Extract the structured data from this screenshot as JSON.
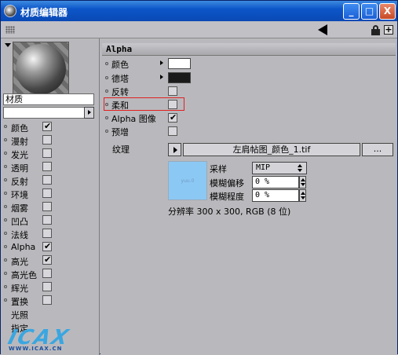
{
  "window": {
    "title": "材质编辑器",
    "controls": {
      "minimize": "_",
      "maximize": "□",
      "close": "X"
    }
  },
  "toolbar": {
    "icons": [
      "grip-icon",
      "back-arrow-icon",
      "lock-icon",
      "plus-icon"
    ],
    "plus_label": "+"
  },
  "left_panel": {
    "material_name": "材质",
    "channels": [
      {
        "label": "颜色",
        "checked": true
      },
      {
        "label": "漫射",
        "checked": false
      },
      {
        "label": "发光",
        "checked": false
      },
      {
        "label": "透明",
        "checked": false
      },
      {
        "label": "反射",
        "checked": false
      },
      {
        "label": "环境",
        "checked": false
      },
      {
        "label": "烟雾",
        "checked": false
      },
      {
        "label": "凹凸",
        "checked": false
      },
      {
        "label": "法线",
        "checked": false
      },
      {
        "label": "Alpha",
        "checked": true
      },
      {
        "label": "高光",
        "checked": true
      },
      {
        "label": "高光色",
        "checked": false
      },
      {
        "label": "辉光",
        "checked": false
      },
      {
        "label": "置换",
        "checked": false
      },
      {
        "label": "光照",
        "checked": false
      },
      {
        "label": "指定",
        "checked": false
      }
    ],
    "logo": {
      "big": "ICAX",
      "small": "WWW.ICAX.CN"
    }
  },
  "alpha_panel": {
    "header": "Alpha",
    "color": {
      "label": "颜色",
      "swatch": "#ffffff"
    },
    "difference": {
      "label": "德塔",
      "swatch": "#1a1a1a"
    },
    "invert": {
      "label": "反转",
      "checked": false
    },
    "soft": {
      "label": "柔和",
      "checked": false
    },
    "alpha_image": {
      "label": "Alpha 图像",
      "checked": true
    },
    "premultiply": {
      "label": "预增",
      "checked": false
    },
    "texture": {
      "label": "纹理",
      "file": "左肩帖图_颜色_1.tif",
      "more_button": "...",
      "thumbnail_color": "#8cc8f4",
      "thumbnail_text": "yuu.0",
      "sampling_label": "采样",
      "sampling_value": "MIP",
      "blur_offset_label": "模糊偏移",
      "blur_offset_value": "0 %",
      "blur_scale_label": "模糊程度",
      "blur_scale_value": "0 %",
      "resolution": "分辨率 300 x 300, RGB (8 位)"
    }
  },
  "colors": {
    "titlebar": "#0c56c9",
    "panel_bg": "#b9b9bd",
    "highlight": "#e02020"
  }
}
